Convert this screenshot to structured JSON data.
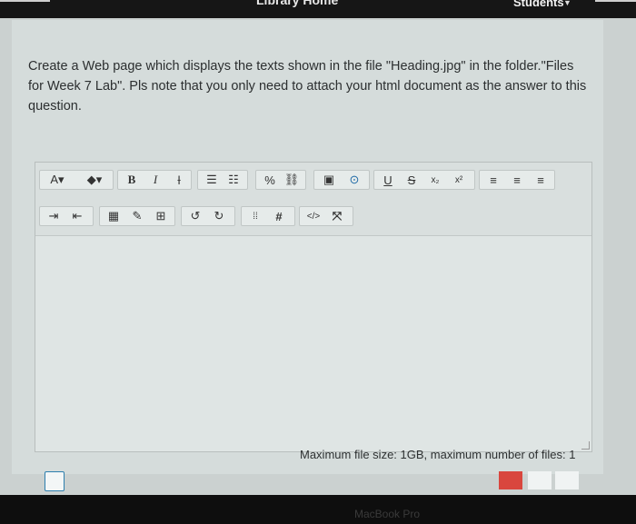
{
  "nav": {
    "home_label": "Library Home",
    "students_label": "Students"
  },
  "question": {
    "text": "Create a Web page which displays the texts shown in the file \"Heading.jpg\" in the folder.\"Files for Week 7 Lab\". Pls note that you only need to attach your html document as the answer to this question."
  },
  "toolbar": {
    "row1": [
      {
        "name": "font-color-button",
        "label": "A▾"
      },
      {
        "name": "highlight-button",
        "label": "◆▾"
      },
      {
        "name": "bold-button",
        "label": "B"
      },
      {
        "name": "italic-button",
        "label": "I"
      },
      {
        "name": "clear-format-button",
        "label": "Ɨ"
      },
      {
        "name": "bullet-list-button",
        "label": "☰"
      },
      {
        "name": "numbered-list-button",
        "label": "☷"
      },
      {
        "name": "link-button",
        "label": "%"
      },
      {
        "name": "unlink-button",
        "label": "⛓"
      },
      {
        "name": "image-button",
        "label": "▣"
      },
      {
        "name": "media-button",
        "label": "⊙"
      },
      {
        "name": "underline-button",
        "label": "U"
      },
      {
        "name": "strikethrough-button",
        "label": "S"
      },
      {
        "name": "subscript-button",
        "label": "x₂"
      },
      {
        "name": "superscript-button",
        "label": "x²"
      },
      {
        "name": "align-left-button",
        "label": "≡"
      },
      {
        "name": "align-center-button",
        "label": "≡"
      },
      {
        "name": "align-right-button",
        "label": "≡"
      }
    ],
    "row2": [
      {
        "name": "indent-button",
        "label": "⇥"
      },
      {
        "name": "outdent-button",
        "label": "⇤"
      },
      {
        "name": "equation-button",
        "label": "▦"
      },
      {
        "name": "edit-button",
        "label": "✎"
      },
      {
        "name": "table-button",
        "label": "⊞"
      },
      {
        "name": "undo-button",
        "label": "↺"
      },
      {
        "name": "redo-button",
        "label": "↻"
      },
      {
        "name": "accessibility-button",
        "label": "⁞⁞"
      },
      {
        "name": "hashtag-button",
        "label": "#"
      },
      {
        "name": "html-button",
        "label": "</>"
      },
      {
        "name": "fullscreen-button",
        "label": "⤧"
      }
    ]
  },
  "filesize_note": "Maximum file size: 1GB, maximum number of files: 1",
  "footer_text": "MacBook Pro"
}
